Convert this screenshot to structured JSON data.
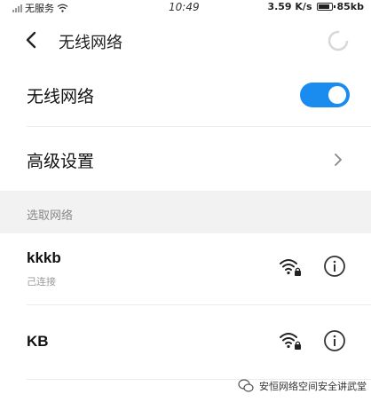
{
  "status_bar": {
    "carrier": "无服务",
    "time": "10:49",
    "speed": "3.59 K/s",
    "battery": "85kb"
  },
  "header": {
    "title": "无线网络"
  },
  "settings": {
    "wlan_label": "无线网络",
    "wlan_enabled": true,
    "advanced_label": "高级设置"
  },
  "section": {
    "label": "选取网络"
  },
  "networks": [
    {
      "name": "kkkb",
      "status": "己连接",
      "secured": true
    },
    {
      "name": "KB",
      "status": "",
      "secured": true
    }
  ],
  "watermark": {
    "text": "安恒网络空间安全讲武堂"
  },
  "icons": [
    "signal-icon",
    "wifi-icon",
    "battery-icon",
    "back-icon",
    "refresh-icon",
    "chevron-right-icon",
    "wifi-lock-icon",
    "info-icon",
    "wechat-icon"
  ],
  "colors": {
    "accent": "#1a8cf0",
    "section_bg": "#f2f2f2",
    "secondary_text": "#999999"
  }
}
